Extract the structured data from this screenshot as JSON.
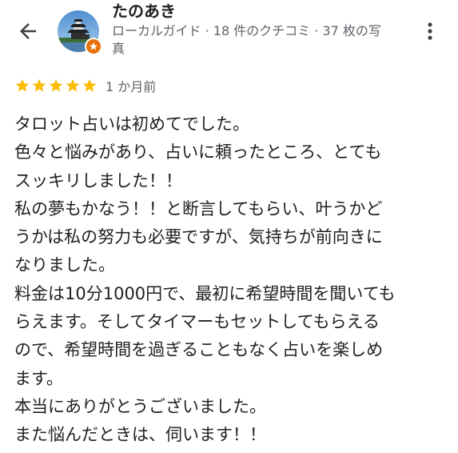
{
  "header": {
    "reviewer_name": "たのあき",
    "reviewer_meta_line1": "ローカルガイド · 18 件のクチコミ · 37 枚の写",
    "reviewer_meta_line2": "真"
  },
  "icons": {
    "back": "arrow-back-icon",
    "more": "more-vert-icon",
    "badge": "local-guide-star-icon",
    "star": "star-icon"
  },
  "review": {
    "rating": 5,
    "max_rating": 5,
    "date": "1 か月前",
    "lines": [
      "タロット占いは初めてでした。",
      "色々と悩みがあり、占いに頼ったところ、とても",
      "スッキリしました！！",
      "私の夢もかなう！！と断言してもらい、叶うかど",
      "うかは私の努力も必要ですが、気持ちが前向きに",
      "なりました。",
      "料金は10分1000円で、最初に希望時間を聞いても",
      "らえます。そしてタイマーもセットしてもらえる",
      "ので、希望時間を過ぎることもなく占いを楽しめ",
      "ます。",
      "本当にありがとうございました。",
      "また悩んだときは、伺います！！"
    ]
  },
  "colors": {
    "star": "#fbbc04",
    "badge": "#e8710a",
    "text_primary": "#202124",
    "text_secondary": "#5f6368"
  }
}
